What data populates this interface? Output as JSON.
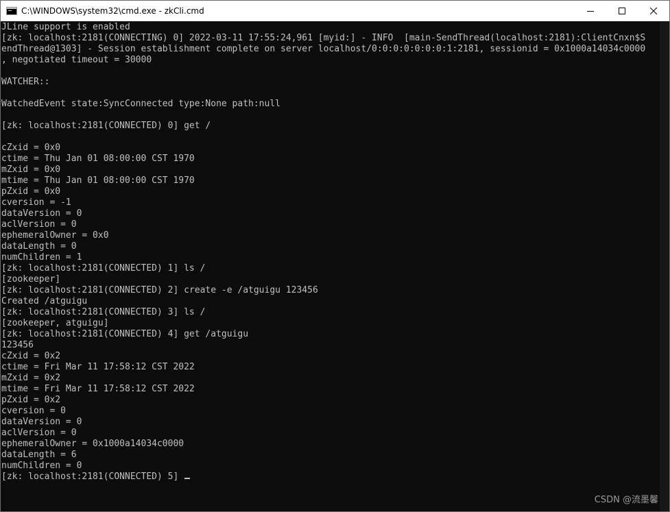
{
  "window": {
    "title": "C:\\WINDOWS\\system32\\cmd.exe - zkCli.cmd"
  },
  "icons": {
    "app": "console-icon",
    "minimize": "minimize-icon",
    "maximize": "maximize-icon",
    "close": "close-icon"
  },
  "terminal": {
    "lines": [
      "JLine support is enabled",
      "[zk: localhost:2181(CONNECTING) 0] 2022-03-11 17:55:24,961 [myid:] - INFO  [main-SendThread(localhost:2181):ClientCnxn$S",
      "endThread@1303] - Session establishment complete on server localhost/0:0:0:0:0:0:0:1:2181, sessionid = 0x1000a14034c0000",
      ", negotiated timeout = 30000",
      "",
      "WATCHER::",
      "",
      "WatchedEvent state:SyncConnected type:None path:null",
      "",
      "[zk: localhost:2181(CONNECTED) 0] get /",
      "",
      "cZxid = 0x0",
      "ctime = Thu Jan 01 08:00:00 CST 1970",
      "mZxid = 0x0",
      "mtime = Thu Jan 01 08:00:00 CST 1970",
      "pZxid = 0x0",
      "cversion = -1",
      "dataVersion = 0",
      "aclVersion = 0",
      "ephemeralOwner = 0x0",
      "dataLength = 0",
      "numChildren = 1",
      "[zk: localhost:2181(CONNECTED) 1] ls /",
      "[zookeeper]",
      "[zk: localhost:2181(CONNECTED) 2] create -e /atguigu 123456",
      "Created /atguigu",
      "[zk: localhost:2181(CONNECTED) 3] ls /",
      "[zookeeper, atguigu]",
      "[zk: localhost:2181(CONNECTED) 4] get /atguigu",
      "123456",
      "cZxid = 0x2",
      "ctime = Fri Mar 11 17:58:12 CST 2022",
      "mZxid = 0x2",
      "mtime = Fri Mar 11 17:58:12 CST 2022",
      "pZxid = 0x2",
      "cversion = 0",
      "dataVersion = 0",
      "aclVersion = 0",
      "ephemeralOwner = 0x1000a14034c0000",
      "dataLength = 6",
      "numChildren = 0"
    ],
    "prompt": "[zk: localhost:2181(CONNECTED) 5] "
  },
  "watermark": "CSDN @流墨馨",
  "colors": {
    "background": "#0c0c0c",
    "text": "#c0c0c0",
    "titlebar": "#ffffff"
  }
}
